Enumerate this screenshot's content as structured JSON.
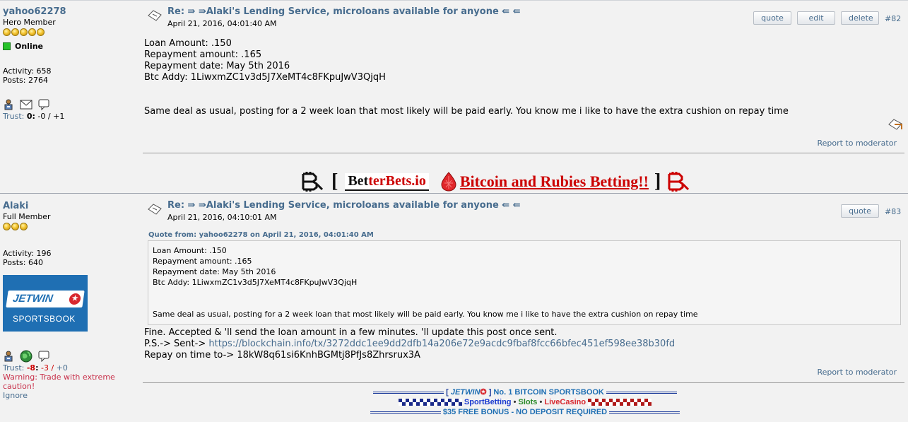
{
  "posts": [
    {
      "username": "yahoo62278",
      "rank": "Hero Member",
      "stars": 5,
      "online_label": "Online",
      "activity": "Activity: 658",
      "posts": "Posts: 2764",
      "trust_label": "Trust:",
      "trust_score": "0",
      "trust_neg": "-0",
      "trust_sep": "/",
      "trust_pos": "+1",
      "subject": "Re: ⇛ ⇛Alaki's Lending Service, microloans available for anyone ⇚ ⇚",
      "date": "April 21, 2016, 04:01:40 AM",
      "buttons": [
        "quote",
        "edit",
        "delete"
      ],
      "post_number": "#82",
      "body_lines": [
        "Loan Amount: .150",
        "Repayment amount: .165",
        "Repayment date: May 5th 2016",
        "Btc Addy: 1LiwxmZC1v3d5J7XeMT4c8FKpuJwV3QjqH"
      ],
      "body_para": "Same deal as usual, posting for a 2 week loan that most likely will be paid early. You know me i like to have the extra cushion on repay time",
      "report": "Report to moderator",
      "signature": {
        "open_bracket": "[",
        "brand_bet": "Bet",
        "brand_ter": "terBets.io",
        "tagline": "Bitcoin and Rubies Betting!!",
        "close_bracket": "]"
      }
    },
    {
      "username": "Alaki",
      "rank": "Full Member",
      "stars": 3,
      "activity": "Activity: 196",
      "posts": "Posts: 640",
      "avatar_ad": {
        "brand": "JETWIN",
        "sub": "SPORTSBOOK"
      },
      "trust_label": "Trust:",
      "trust_score": "-8",
      "trust_neg": "-3",
      "trust_sep": "/",
      "trust_pos": "+0",
      "warning": "Warning: Trade with extreme caution!",
      "ignore": "Ignore",
      "subject": "Re: ⇛ ⇛Alaki's Lending Service, microloans available for anyone ⇚ ⇚",
      "date": "April 21, 2016, 04:10:01 AM",
      "buttons": [
        "quote"
      ],
      "post_number": "#83",
      "quote_header": "Quote from: yahoo62278 on April 21, 2016, 04:01:40 AM",
      "quote_lines": [
        "Loan Amount: .150",
        "Repayment amount: .165",
        "Repayment date: May 5th 2016",
        "Btc Addy: 1LiwxmZC1v3d5J7XeMT4c8FKpuJwV3QjqH"
      ],
      "quote_para": "Same deal as usual, posting for a 2 week loan that most likely will be paid early. You know me i like to have the extra cushion on repay time",
      "reply_line1": "Fine. Accepted & 'll send the loan amount in a few minutes. 'll update this post once sent.",
      "reply_ps_prefix": "P.S.-> Sent->",
      "reply_link": "https://blockchain.info/tx/3272ddc1ee9dd2dfb14a206e72e9acdc9fbaf8fcc66bfec451ef598ee38b30fd",
      "reply_line3": "Repay on time to-> 18kW8q61si6KnhBGMtj8PfJs8Zhrsrux3A",
      "report": "Report to moderator",
      "signature": {
        "open": "[",
        "brand": "JETWIN",
        "close": "]",
        "tagline": "No. 1 BITCOIN SPORTSBOOK",
        "sport": "SportBetting",
        "bullet": "•",
        "slots": "Slots",
        "casino": "LiveCasino",
        "bonus": "$35 FREE BONUS - NO DEPOSIT REQUIRED"
      }
    }
  ],
  "colors": {
    "link": "#476c8e",
    "post_bg": "#f2f2f2",
    "online": "#27c22a",
    "negative_trust": "#cc0000",
    "warning": "#c8304a",
    "betterbets_red": "#cc0000",
    "jetwin_blue": "#1f6fb3"
  },
  "icons": [
    "profile-icon",
    "email-icon",
    "pm-icon",
    "website-icon",
    "message-icon",
    "quick-quote-icon",
    "post-icon"
  ]
}
